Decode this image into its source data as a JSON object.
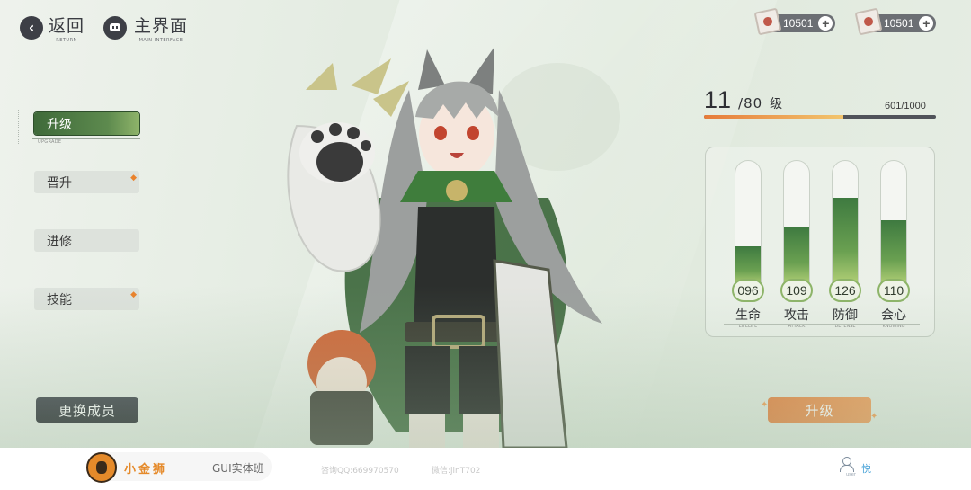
{
  "header": {
    "back": {
      "label": "返回",
      "sub": "RETURN"
    },
    "home": {
      "label": "主界面",
      "sub": "MAIN INTERFACE"
    }
  },
  "currencies": [
    {
      "icon": "ticket-card-icon",
      "amount": "10501"
    },
    {
      "icon": "gift-card-icon",
      "amount": "10501"
    }
  ],
  "menu": {
    "items": [
      {
        "label": "升级",
        "sub": "UPGRADE",
        "active": true
      },
      {
        "label": "晋升",
        "badge": "◆"
      },
      {
        "label": "进修"
      },
      {
        "label": "技能",
        "badge": "◆"
      }
    ],
    "swap_label": "更换成员"
  },
  "level": {
    "current": "11",
    "max": "/80",
    "unit": "级",
    "exp_text": "601/1000",
    "exp_fraction": 0.601
  },
  "stats": [
    {
      "name": "生命",
      "sub": "LIFELIFE",
      "value": "096",
      "fill": 0.32
    },
    {
      "name": "攻击",
      "sub": "ATTACK",
      "value": "109",
      "fill": 0.48
    },
    {
      "name": "防御",
      "sub": "DEFENSE",
      "value": "126",
      "fill": 0.71
    },
    {
      "name": "会心",
      "sub": "KNOWING",
      "value": "110",
      "fill": 0.53
    }
  ],
  "upgrade_label": "升级",
  "footer": {
    "brand": "小金狮",
    "course": "GUI实体班",
    "contact_qq": "咨询QQ:669970570",
    "contact_wx": "微信:jinT702",
    "user_sub": "user",
    "user_name": "悦"
  },
  "colors": {
    "accent_green": "#5d8a4e",
    "accent_orange": "#e7894a",
    "dark": "#3d3f46"
  }
}
